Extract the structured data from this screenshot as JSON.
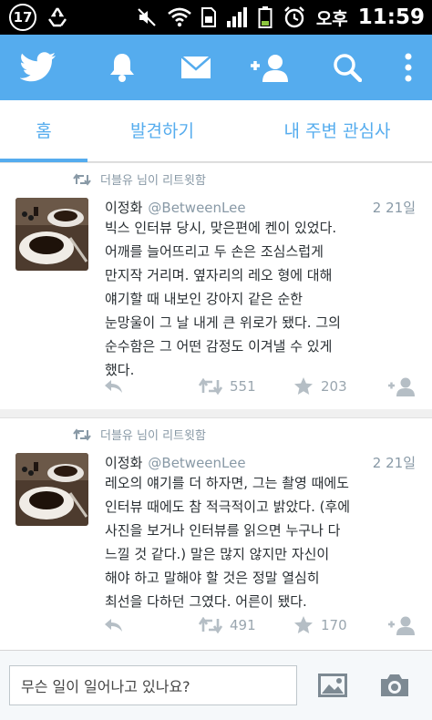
{
  "status_bar": {
    "notification_count": "17",
    "carrier": "오후",
    "time": "11:59"
  },
  "action_bar": {
    "icons": [
      "twitter-bird-icon",
      "notifications-bell-icon",
      "messages-envelope-icon",
      "add-user-icon",
      "search-icon",
      "overflow-menu-icon"
    ],
    "color": "#55acee"
  },
  "tabs": [
    {
      "label": "홈",
      "active": true
    },
    {
      "label": "발견하기",
      "active": false
    },
    {
      "label": "내 주변 관심사",
      "active": false
    }
  ],
  "tweets": [
    {
      "retweet_note": "더블유 님이 리트윗함",
      "name": "이정화",
      "handle": "@BetweenLee",
      "date": "2 21일",
      "text": "빅스 인터뷰 당시, 맞은편에 켄이  있었다.\n어깨를 늘어뜨리고 두 손은 조심스럽게\n만지작 거리며. 옆자리의 레오 형에 대해\n얘기할 때 내보인 강아지 같은 순한\n눈망울이 그 날 내게 큰 위로가 됐다. 그의\n순수함은 그 어떤 감정도 이겨낼 수 있게\n했다.",
      "retweets": "551",
      "favorites": "203"
    },
    {
      "retweet_note": "더블유 님이 리트윗함",
      "name": "이정화",
      "handle": "@BetweenLee",
      "date": "2 21일",
      "text": "레오의 얘기를 더 하자면, 그는 촬영 때에도\n인터뷰 때에도 참 적극적이고 밝았다. (후에\n사진을 보거나 인터뷰를 읽으면 누구나 다\n느낄 것 같다.) 말은 많지 않지만 자신이\n해야 하고 말해야 할 것은 정말 열심히\n최선을 다하던 그였다. 어른이 됐다.",
      "retweets": "491",
      "favorites": "170"
    }
  ],
  "compose": {
    "placeholder": "무슨 일이 일어나고 있나요?",
    "icons": [
      "photo-gallery-icon",
      "camera-icon"
    ]
  },
  "colors": {
    "accent": "#55acee",
    "text_primary": "#292f33",
    "text_secondary": "#8899a6"
  }
}
